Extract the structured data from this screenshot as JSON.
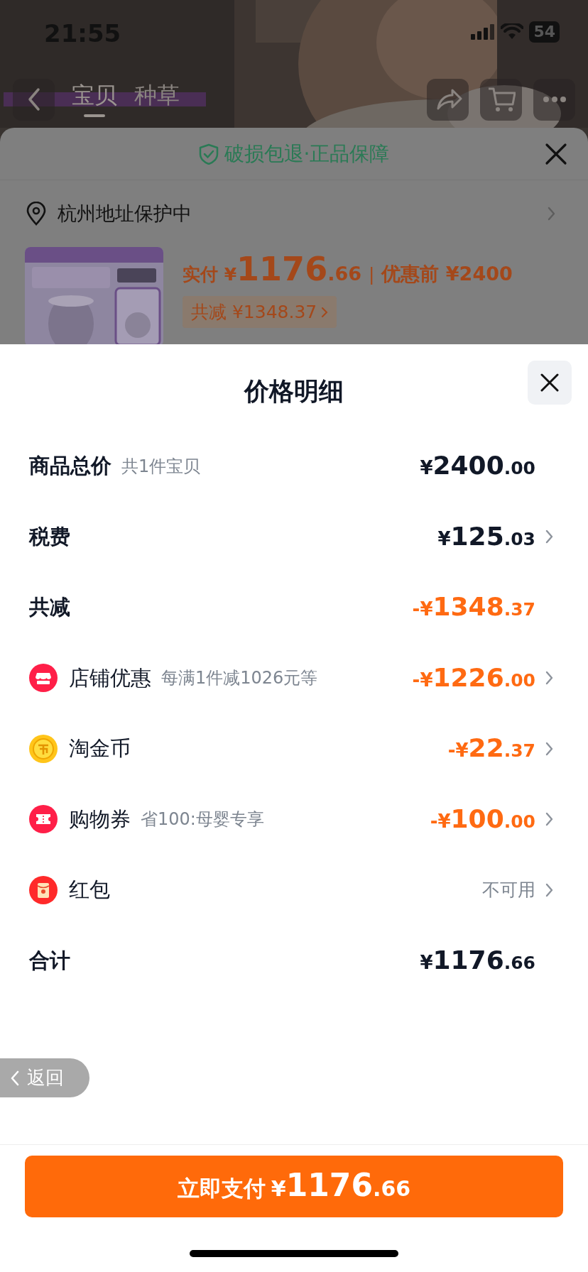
{
  "status_bar": {
    "time": "21:55",
    "battery": "54"
  },
  "nav": {
    "tabs": [
      {
        "label": "宝贝",
        "selected": true
      },
      {
        "label": "种草",
        "selected": false
      }
    ]
  },
  "order_sheet": {
    "guarantee": "破损包退·正品保障",
    "address": "杭州地址保护中",
    "paid_label": "实付",
    "paid_currency": "¥",
    "paid_whole": "1176",
    "paid_cents": ".66",
    "separator": "|",
    "original_label": "优惠前",
    "original_price": "¥2400",
    "discount": "共减 ¥1348.37"
  },
  "price_detail": {
    "title": "价格明细",
    "rows": [
      {
        "kind": "plain",
        "label": "商品总价",
        "note": "共1件宝贝",
        "prefix": "¥",
        "whole": "2400",
        "cents": ".00",
        "highlight": false,
        "arrow": false
      },
      {
        "kind": "plain",
        "label": "税费",
        "prefix": "¥",
        "whole": "125",
        "cents": ".03",
        "highlight": false,
        "arrow": true
      },
      {
        "kind": "plain",
        "label": "共减",
        "prefix": "-¥",
        "whole": "1348",
        "cents": ".37",
        "highlight": true,
        "arrow": false
      },
      {
        "kind": "store",
        "label": "店铺优惠",
        "note": "每满1件减1026元等",
        "prefix": "-¥",
        "whole": "1226",
        "cents": ".00",
        "highlight": true,
        "arrow": true
      },
      {
        "kind": "coin",
        "label": "淘金币",
        "prefix": "-¥",
        "whole": "22",
        "cents": ".37",
        "highlight": true,
        "arrow": true
      },
      {
        "kind": "coupon",
        "label": "购物券",
        "note": "省100:母婴专享",
        "prefix": "-¥",
        "whole": "100",
        "cents": ".00",
        "highlight": true,
        "arrow": true
      },
      {
        "kind": "envelope",
        "label": "红包",
        "status": "不可用",
        "arrow": true
      },
      {
        "kind": "plain",
        "label": "合计",
        "prefix": "¥",
        "whole": "1176",
        "cents": ".66",
        "highlight": false,
        "arrow": false
      }
    ]
  },
  "back_button": "返回",
  "pay_button": {
    "label": "立即支付",
    "prefix": "¥",
    "whole": "1176",
    "cents": ".66"
  }
}
